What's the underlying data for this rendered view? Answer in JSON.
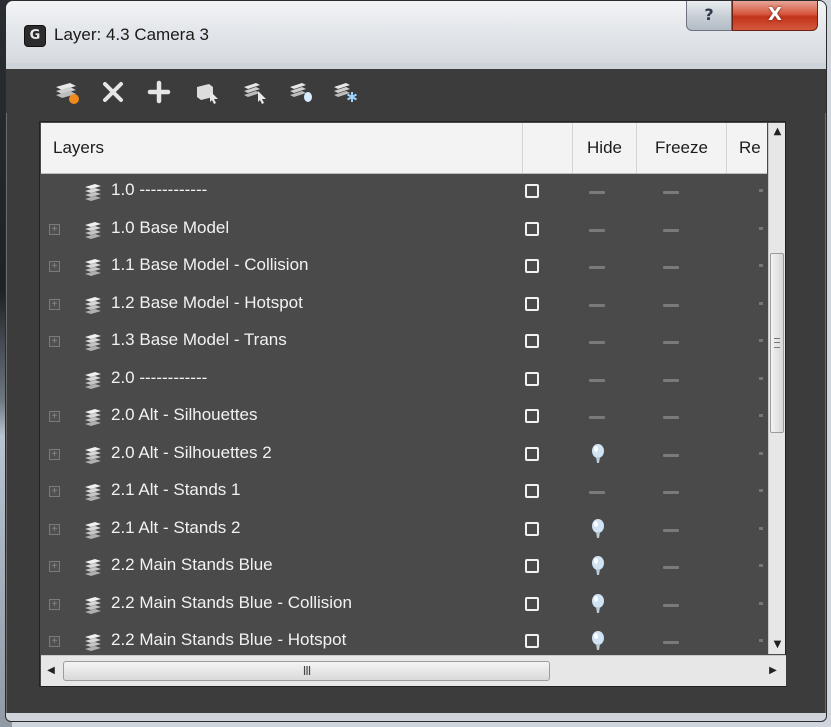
{
  "window": {
    "title": "Layer: 4.3 Camera 3",
    "app_icon_glyph": "G",
    "help_label": "?",
    "close_label": "X"
  },
  "toolbar": {
    "items": [
      {
        "name": "new-layer-icon"
      },
      {
        "name": "delete-layer-icon"
      },
      {
        "name": "add-selected-icon"
      },
      {
        "name": "select-objects-icon"
      },
      {
        "name": "highlight-selected-icon"
      },
      {
        "name": "hide-all-layers-icon"
      },
      {
        "name": "freeze-all-layers-icon"
      }
    ]
  },
  "list": {
    "columns": {
      "layers": "Layers",
      "current": "",
      "hide": "Hide",
      "freeze": "Freeze",
      "render": "Re"
    },
    "rows": [
      {
        "name": "1.0 ------------",
        "expandable": false,
        "hidden": false
      },
      {
        "name": "1.0 Base Model",
        "expandable": true,
        "hidden": false
      },
      {
        "name": "1.1 Base Model - Collision",
        "expandable": true,
        "hidden": false
      },
      {
        "name": "1.2 Base Model - Hotspot",
        "expandable": true,
        "hidden": false
      },
      {
        "name": "1.3 Base Model - Trans",
        "expandable": true,
        "hidden": false
      },
      {
        "name": "2.0 ------------",
        "expandable": false,
        "hidden": false
      },
      {
        "name": "2.0 Alt - Silhouettes",
        "expandable": true,
        "hidden": false
      },
      {
        "name": "2.0 Alt - Silhouettes 2",
        "expandable": true,
        "hidden": true
      },
      {
        "name": "2.1 Alt - Stands 1",
        "expandable": true,
        "hidden": false
      },
      {
        "name": "2.1 Alt - Stands 2",
        "expandable": true,
        "hidden": true
      },
      {
        "name": "2.2 Main Stands Blue",
        "expandable": true,
        "hidden": true
      },
      {
        "name": "2.2 Main Stands Blue - Collision",
        "expandable": true,
        "hidden": true
      },
      {
        "name": "2.2 Main Stands Blue - Hotspot",
        "expandable": true,
        "hidden": true
      }
    ]
  },
  "scrollbars": {
    "up": "▲",
    "down": "▼",
    "left": "◀",
    "right": "▶",
    "hthumb_grip": "III"
  },
  "colors": {
    "list_bg": "#4a4a4a",
    "window_bg": "#3c3c3c",
    "close_red": "#c2331b",
    "bulb": "#cfe3f4"
  }
}
